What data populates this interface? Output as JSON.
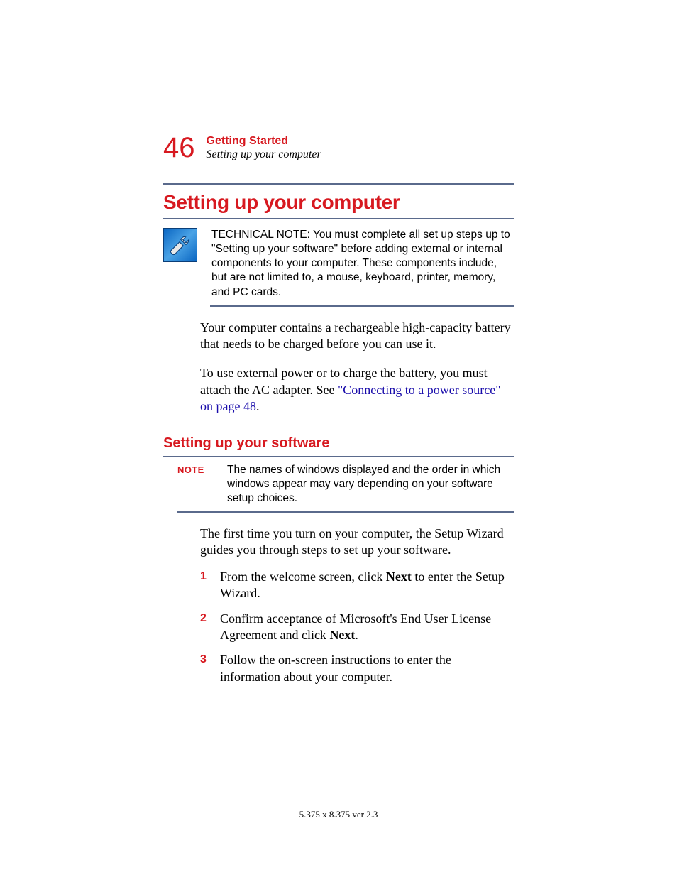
{
  "header": {
    "page_number": "46",
    "chapter": "Getting Started",
    "section": "Setting up your computer"
  },
  "h1": "Setting up your computer",
  "tech_note": "TECHNICAL NOTE: You must complete all set up steps up to \"Setting up your software\" before adding external or internal components to your computer. These components include, but are not limited to, a mouse, keyboard, printer, memory, and PC cards.",
  "para1": "Your computer contains a rechargeable high-capacity battery that needs to be charged before you can use it.",
  "para2_pre": "To use external power or to charge the battery, you must attach the AC adapter. See ",
  "para2_link": "\"Connecting to a power source\" on page 48",
  "para2_post": ".",
  "h2": "Setting up your software",
  "note_label": "NOTE",
  "note_text": "The names of windows displayed and the order in which windows appear may vary depending on your software setup choices.",
  "para3": "The first time you turn on your computer, the Setup Wizard guides you through steps to set up your software.",
  "steps": [
    {
      "num": "1",
      "pre": "From the welcome screen, click ",
      "bold": "Next",
      "post": " to enter the Setup Wizard."
    },
    {
      "num": "2",
      "pre": "Confirm acceptance of Microsoft's End User License Agreement and click ",
      "bold": "Next",
      "post": "."
    },
    {
      "num": "3",
      "pre": "Follow the on-screen instructions to enter the information about your computer.",
      "bold": "",
      "post": ""
    }
  ],
  "footer": "5.375 x 8.375 ver 2.3"
}
